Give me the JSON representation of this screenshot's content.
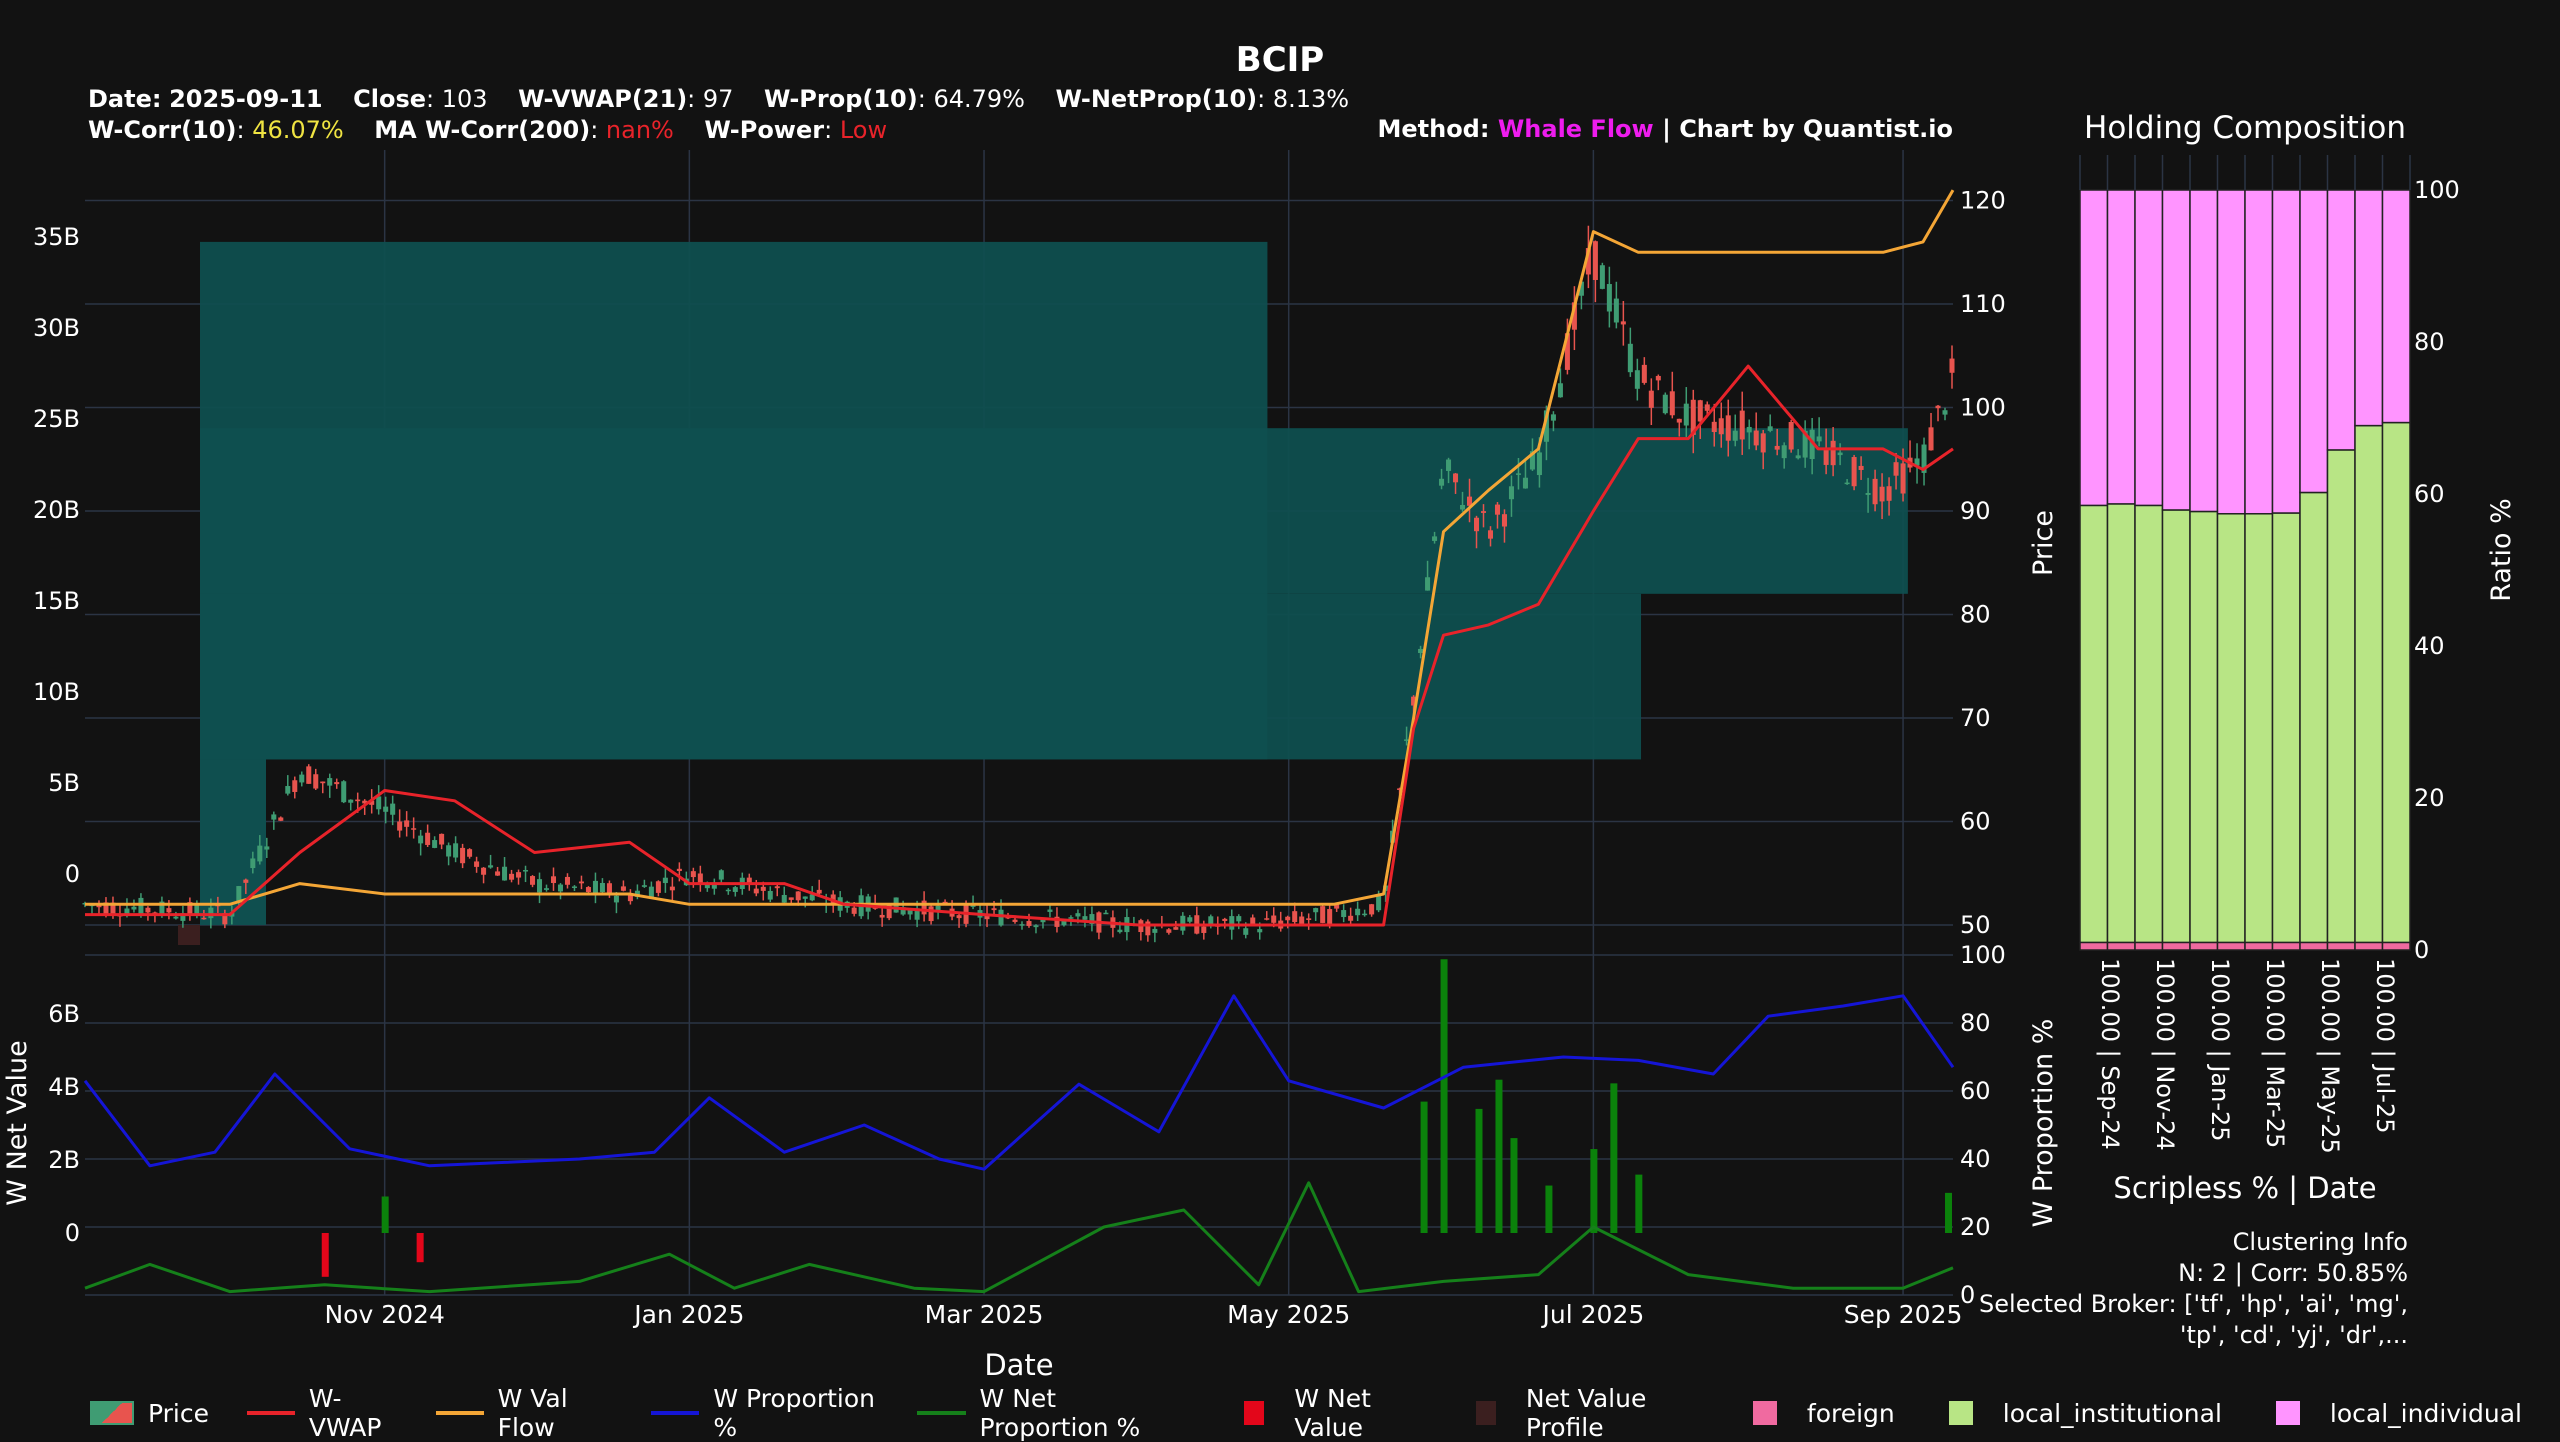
{
  "title": "BCIP",
  "header": {
    "line1": [
      {
        "label": "Date:",
        "value": "2025-09-11"
      },
      {
        "label": "Close",
        "value": ": 103"
      },
      {
        "label": "W-VWAP(21)",
        "value": ": 97"
      },
      {
        "label": "W-Prop(10)",
        "value": ": 64.79%"
      },
      {
        "label": "W-NetProp(10)",
        "value": ": 8.13%"
      }
    ],
    "line2": [
      {
        "label": "W-Corr(10)",
        "sep": ": ",
        "value": "46.07%",
        "color": "#f0e442"
      },
      {
        "label": "MA W-Corr(200)",
        "sep": ": ",
        "value": "nan%",
        "color": "#e8232a"
      },
      {
        "label": "W-Power",
        "sep": ": ",
        "value": "Low",
        "color": "#e8232a"
      }
    ],
    "method_label": "Method: ",
    "method_value": "Whale Flow",
    "method_suffix": " | Chart by Quantist.io"
  },
  "colors": {
    "background": "#121212",
    "grid": "#2b3444",
    "up": "#3f9c73",
    "down": "#e8544e",
    "vwap": "#e8232a",
    "valflow": "#f4a636",
    "proportion": "#1515d6",
    "netprop": "#15801a",
    "netvalue_pos": "#0b820b",
    "netvalue_neg": "#e3061a",
    "profile": "#0f4f4f",
    "profile_dark": "#3b1f1f",
    "foreign": "#f06aa0",
    "local_institutional": "#b8e585",
    "local_individual": "#ff94ff",
    "method": "#ee1cee",
    "corr": "#f0e442"
  },
  "xaxis": {
    "label": "Date",
    "ticks": [
      "Nov 2024",
      "Jan 2025",
      "Mar 2025",
      "May 2025",
      "Jul 2025",
      "Sep 2025"
    ]
  },
  "legend": [
    {
      "label": "Price",
      "kind": "candle"
    },
    {
      "label": "W-VWAP",
      "kind": "line",
      "color": "#e8232a"
    },
    {
      "label": "W Val Flow",
      "kind": "line",
      "color": "#f4a636"
    },
    {
      "label": "W Proportion %",
      "kind": "line",
      "color": "#1515d6"
    },
    {
      "label": "W Net Proportion %",
      "kind": "line",
      "color": "#15801a"
    },
    {
      "label": "W Net Value",
      "kind": "box",
      "color": "#e3061a"
    },
    {
      "label": "Net Value Profile",
      "kind": "box",
      "color": "#3b1f1f"
    },
    {
      "label": "foreign",
      "kind": "box",
      "color": "#f06aa0"
    },
    {
      "label": "local_institutional",
      "kind": "box",
      "color": "#b8e585"
    },
    {
      "label": "local_individual",
      "kind": "box",
      "color": "#ff94ff"
    }
  ],
  "holding": {
    "title": "Holding Composition",
    "xlabel": "Scripless % | Date",
    "ylabel": "Ratio %",
    "yticks": [
      "0",
      "20",
      "40",
      "60",
      "80",
      "100"
    ],
    "xtick_labels": [
      "100.00 | Sep-24",
      "100.00 | Nov-24",
      "100.00 | Jan-25",
      "100.00 | Mar-25",
      "100.00 | May-25",
      "100.00 | Jul-25"
    ]
  },
  "cluster": {
    "line1": "Clustering Info",
    "line2": "N: 2 | Corr: 50.85%",
    "line3": "Selected Broker: ['tf', 'hp', 'ai', 'mg',",
    "line4": "'tp', 'cd', 'yj', 'dr',..."
  },
  "chart_data": [
    {
      "type": "candlestick",
      "name": "price-panel",
      "ylabel": "Price",
      "ylim": [
        49,
        122
      ],
      "y_right_ticks": [
        "50",
        "60",
        "70",
        "80",
        "90",
        "100",
        "110",
        "120"
      ],
      "y_left_ticks": [
        "0",
        "5B",
        "10B",
        "15B",
        "20B",
        "25B",
        "30B",
        "35B"
      ],
      "y_left_range": [
        -5,
        39
      ],
      "dates": [
        "2024-09-02",
        "2024-10-01",
        "2024-10-15",
        "2024-11-01",
        "2024-11-15",
        "2024-12-01",
        "2024-12-20",
        "2025-01-01",
        "2025-01-20",
        "2025-02-01",
        "2025-03-01",
        "2025-04-01",
        "2025-04-25",
        "2025-05-10",
        "2025-05-20",
        "2025-05-26",
        "2025-06-01",
        "2025-06-10",
        "2025-06-20",
        "2025-07-01",
        "2025-07-10",
        "2025-07-20",
        "2025-08-01",
        "2025-08-15",
        "2025-08-28",
        "2025-09-05",
        "2025-09-11"
      ],
      "close": [
        52,
        51,
        65,
        61,
        57,
        54,
        53,
        55,
        53,
        52,
        51,
        50,
        50,
        51,
        52,
        72,
        94,
        88,
        95,
        115,
        103,
        99,
        98,
        96,
        92,
        95,
        103
      ],
      "w_vwap": [
        51,
        51,
        57,
        63,
        62,
        57,
        58,
        54,
        54,
        52,
        51,
        50,
        50,
        50,
        50,
        69,
        78,
        79,
        81,
        90,
        97,
        97,
        104,
        96,
        96,
        94,
        96
      ],
      "w_val_flow": [
        52,
        52,
        54,
        53,
        53,
        53,
        53,
        52,
        52,
        52,
        52,
        52,
        52,
        52,
        53,
        70,
        88,
        92,
        96,
        117,
        115,
        115,
        115,
        115,
        115,
        116,
        121
      ],
      "volume_profile": [
        {
          "price_low": 66.0,
          "price_high": 116.0,
          "value": 20.0
        },
        {
          "price_low": 82.0,
          "price_high": 98.0,
          "value": 32.0
        },
        {
          "price_low": 66.0,
          "price_high": 82.0,
          "value": 27.0
        }
      ]
    },
    {
      "type": "line",
      "name": "whale-panel",
      "ylabel_left": "W Net Value",
      "ylabel_right": "W Proportion %",
      "y_left_ticks": [
        "0",
        "2B",
        "4B",
        "6B"
      ],
      "y_right_ticks": [
        "0",
        "20",
        "40",
        "60",
        "80",
        "100"
      ],
      "series": [
        {
          "name": "W Proportion %",
          "dates": [
            "2024-09-02",
            "2024-09-15",
            "2024-09-28",
            "2024-10-10",
            "2024-10-25",
            "2024-11-10",
            "2024-11-25",
            "2024-12-10",
            "2024-12-25",
            "2025-01-05",
            "2025-01-20",
            "2025-02-05",
            "2025-02-20",
            "2025-03-01",
            "2025-03-20",
            "2025-04-05",
            "2025-04-20",
            "2025-05-01",
            "2025-05-20",
            "2025-06-05",
            "2025-06-25",
            "2025-07-10",
            "2025-07-25",
            "2025-08-05",
            "2025-08-20",
            "2025-09-01",
            "2025-09-11"
          ],
          "values": [
            63,
            38,
            42,
            65,
            43,
            38,
            39,
            40,
            42,
            58,
            42,
            50,
            40,
            37,
            62,
            48,
            88,
            63,
            55,
            67,
            70,
            69,
            65,
            82,
            85,
            88,
            67
          ]
        },
        {
          "name": "W Net Proportion %",
          "dates": [
            "2024-09-02",
            "2024-09-15",
            "2024-10-01",
            "2024-10-20",
            "2024-11-10",
            "2024-12-10",
            "2024-12-28",
            "2025-01-10",
            "2025-01-25",
            "2025-02-15",
            "2025-03-01",
            "2025-03-25",
            "2025-04-10",
            "2025-04-25",
            "2025-05-05",
            "2025-05-15",
            "2025-06-01",
            "2025-06-20",
            "2025-07-01",
            "2025-07-20",
            "2025-08-10",
            "2025-09-01",
            "2025-09-11"
          ],
          "values": [
            2,
            9,
            1,
            3,
            1,
            4,
            12,
            2,
            9,
            2,
            1,
            20,
            25,
            3,
            33,
            1,
            4,
            6,
            20,
            6,
            2,
            2,
            8
          ]
        }
      ],
      "net_value_bars": [
        {
          "date": "2024-10-20",
          "value": -1.2
        },
        {
          "date": "2024-11-08",
          "value": -0.8
        },
        {
          "date": "2024-11-01",
          "value": 1.0
        },
        {
          "date": "2025-05-28",
          "value": 3.6
        },
        {
          "date": "2025-06-01",
          "value": 7.5
        },
        {
          "date": "2025-06-08",
          "value": 3.4
        },
        {
          "date": "2025-06-12",
          "value": 4.2
        },
        {
          "date": "2025-06-15",
          "value": 2.6
        },
        {
          "date": "2025-06-22",
          "value": 1.3
        },
        {
          "date": "2025-07-01",
          "value": 2.3
        },
        {
          "date": "2025-07-05",
          "value": 4.1
        },
        {
          "date": "2025-07-10",
          "value": 1.6
        },
        {
          "date": "2025-09-10",
          "value": 1.1
        }
      ]
    },
    {
      "type": "bar",
      "name": "holding-composition",
      "categories": [
        "Sep-24",
        "",
        "Nov-24",
        "",
        "Jan-25",
        "",
        "Mar-25",
        "",
        "May-25",
        "",
        "Jul-25",
        ""
      ],
      "series": [
        {
          "name": "foreign",
          "values": [
            1,
            1,
            1,
            1,
            1,
            1,
            1,
            1,
            1,
            1,
            1,
            1
          ]
        },
        {
          "name": "local_institutional",
          "values": [
            57.5,
            57.7,
            57.5,
            56.9,
            56.7,
            56.4,
            56.4,
            56.5,
            59.2,
            64.8,
            68.0,
            68.4
          ]
        },
        {
          "name": "local_individual",
          "values": [
            41.5,
            41.3,
            41.5,
            42.1,
            42.3,
            42.6,
            42.6,
            42.5,
            39.8,
            34.2,
            31.0,
            30.6
          ]
        }
      ]
    }
  ]
}
